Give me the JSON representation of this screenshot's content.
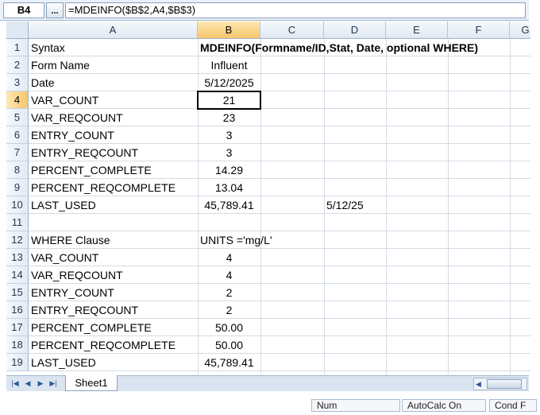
{
  "formula_bar": {
    "name_box": "B4",
    "fx_button": "...",
    "formula": "=MDEINFO($B$2,A4,$B$3)"
  },
  "columns": [
    "A",
    "B",
    "C",
    "D",
    "E",
    "F",
    "G"
  ],
  "rows": [
    {
      "n": "1",
      "a": "Syntax",
      "b": "MDEINFO(Formname/ID,Stat, Date, optional WHERE)",
      "d": ""
    },
    {
      "n": "2",
      "a": "Form Name",
      "b": "Influent",
      "d": ""
    },
    {
      "n": "3",
      "a": "Date",
      "b": "5/12/2025",
      "d": ""
    },
    {
      "n": "4",
      "a": "VAR_COUNT",
      "b": "21",
      "d": ""
    },
    {
      "n": "5",
      "a": "VAR_REQCOUNT",
      "b": "23",
      "d": ""
    },
    {
      "n": "6",
      "a": "ENTRY_COUNT",
      "b": "3",
      "d": ""
    },
    {
      "n": "7",
      "a": "ENTRY_REQCOUNT",
      "b": "3",
      "d": ""
    },
    {
      "n": "8",
      "a": "PERCENT_COMPLETE",
      "b": "14.29",
      "d": ""
    },
    {
      "n": "9",
      "a": "PERCENT_REQCOMPLETE",
      "b": "13.04",
      "d": ""
    },
    {
      "n": "10",
      "a": "LAST_USED",
      "b": "45,789.41",
      "d": "5/12/25"
    },
    {
      "n": "11",
      "a": "",
      "b": "",
      "d": ""
    },
    {
      "n": "12",
      "a": "WHERE Clause",
      "b": "UNITS ='mg/L'",
      "d": ""
    },
    {
      "n": "13",
      "a": "VAR_COUNT",
      "b": "4",
      "d": ""
    },
    {
      "n": "14",
      "a": "VAR_REQCOUNT",
      "b": "4",
      "d": ""
    },
    {
      "n": "15",
      "a": "ENTRY_COUNT",
      "b": "2",
      "d": ""
    },
    {
      "n": "16",
      "a": "ENTRY_REQCOUNT",
      "b": "2",
      "d": ""
    },
    {
      "n": "17",
      "a": "PERCENT_COMPLETE",
      "b": "50.00",
      "d": ""
    },
    {
      "n": "18",
      "a": "PERCENT_REQCOMPLETE",
      "b": "50.00",
      "d": ""
    },
    {
      "n": "19",
      "a": "LAST_USED",
      "b": "45,789.41",
      "d": ""
    }
  ],
  "selected_cell": {
    "row": "4",
    "col": "B"
  },
  "sheet_tabs": [
    "Sheet1"
  ],
  "status_bar": {
    "num": "Num",
    "autocalc": "AutoCalc On",
    "cond": "Cond F"
  },
  "colors": {
    "header_bg": "#dfe8f3",
    "active_header": "#f6c56a",
    "gridline": "#d4dbe4"
  }
}
